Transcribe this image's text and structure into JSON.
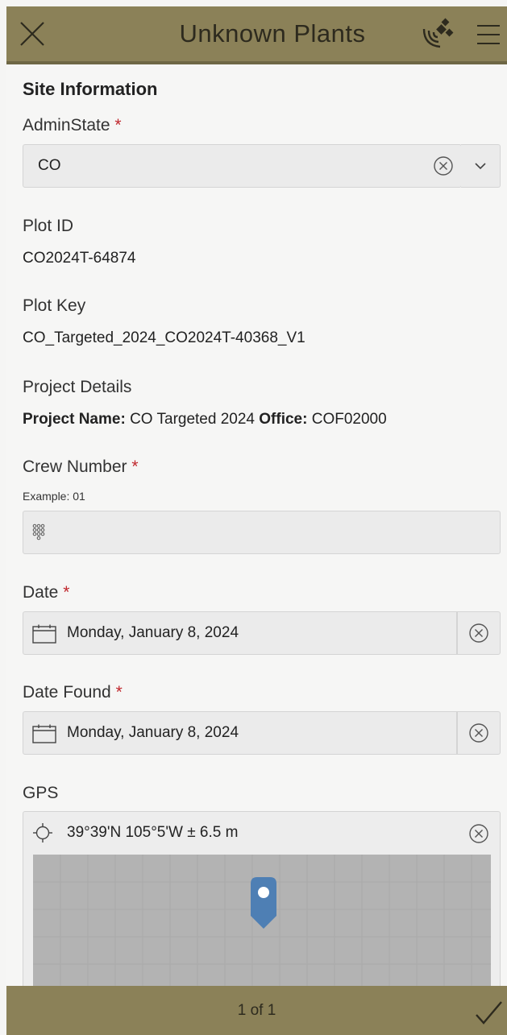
{
  "header": {
    "title": "Unknown Plants",
    "close_icon": "close-icon",
    "gps_icon": "satellite-icon",
    "menu_icon": "hamburger-menu-icon"
  },
  "form": {
    "section_title": "Site Information",
    "admin_state": {
      "label": "AdminState",
      "required_mark": "*",
      "value": "CO"
    },
    "plot_id": {
      "label": "Plot ID",
      "value": "CO2024T-64874"
    },
    "plot_key": {
      "label": "Plot Key",
      "value": "CO_Targeted_2024_CO2024T-40368_V1"
    },
    "project_details": {
      "label": "Project Details",
      "name_label": "Project Name:",
      "name_value": "CO Targeted 2024",
      "office_label": "Office:",
      "office_value": "COF02000"
    },
    "crew_number": {
      "label": "Crew Number",
      "required_mark": "*",
      "hint": "Example: 01",
      "value": ""
    },
    "date": {
      "label": "Date",
      "required_mark": "*",
      "value": "Monday, January 8, 2024"
    },
    "date_found": {
      "label": "Date Found",
      "required_mark": "*",
      "value": "Monday, January 8, 2024"
    },
    "gps": {
      "label": "GPS",
      "value": "39°39'N 105°5'W ± 6.5 m"
    }
  },
  "footer": {
    "page_indicator": "1 of 1",
    "submit_icon": "checkmark-icon"
  },
  "colors": {
    "header": "#8b8158",
    "required": "#c0272d",
    "map_marker": "#4e7fb4"
  }
}
